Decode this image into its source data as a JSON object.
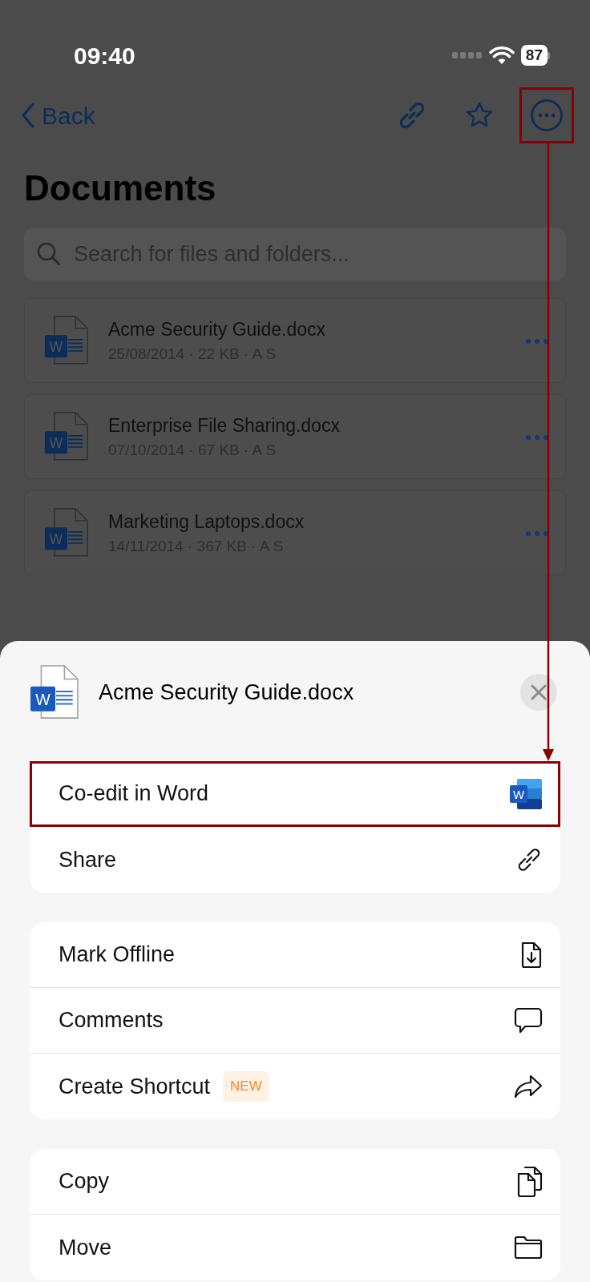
{
  "status_bar": {
    "time": "09:40",
    "battery": "87"
  },
  "nav": {
    "back": "Back",
    "actions": [
      {
        "kind": "link",
        "highlighted": false
      },
      {
        "kind": "star",
        "highlighted": false
      },
      {
        "kind": "more",
        "highlighted": true
      }
    ]
  },
  "title": "Documents",
  "search": {
    "placeholder": "Search for files and folders..."
  },
  "files": [
    {
      "icon_letter": "W",
      "name": "Acme Security Guide.docx",
      "meta": "25/08/2014 · 22 KB · A S"
    },
    {
      "icon_letter": "W",
      "name": "Enterprise File Sharing.docx",
      "meta": "07/10/2014 · 67 KB · A S"
    },
    {
      "icon_letter": "W",
      "name": "Marketing Laptops.docx",
      "meta": "14/11/2014 · 367 KB · A S"
    }
  ],
  "sheet": {
    "icon_letter": "W",
    "file_name": "Acme Security Guide.docx",
    "groups": [
      [
        {
          "label": "Co-edit in Word",
          "kind": "word",
          "icon_letter": "W",
          "highlighted": true
        },
        {
          "label": "Share",
          "kind": "link",
          "highlighted": false
        }
      ],
      [
        {
          "label": "Mark Offline",
          "kind": "download",
          "highlighted": false
        },
        {
          "label": "Comments",
          "kind": "comment",
          "highlighted": false
        },
        {
          "label": "Create Shortcut",
          "badge": "NEW",
          "kind": "forward",
          "highlighted": false
        }
      ],
      [
        {
          "label": "Copy",
          "kind": "copy",
          "highlighted": false
        },
        {
          "label": "Move",
          "kind": "folder",
          "highlighted": false
        }
      ]
    ]
  }
}
